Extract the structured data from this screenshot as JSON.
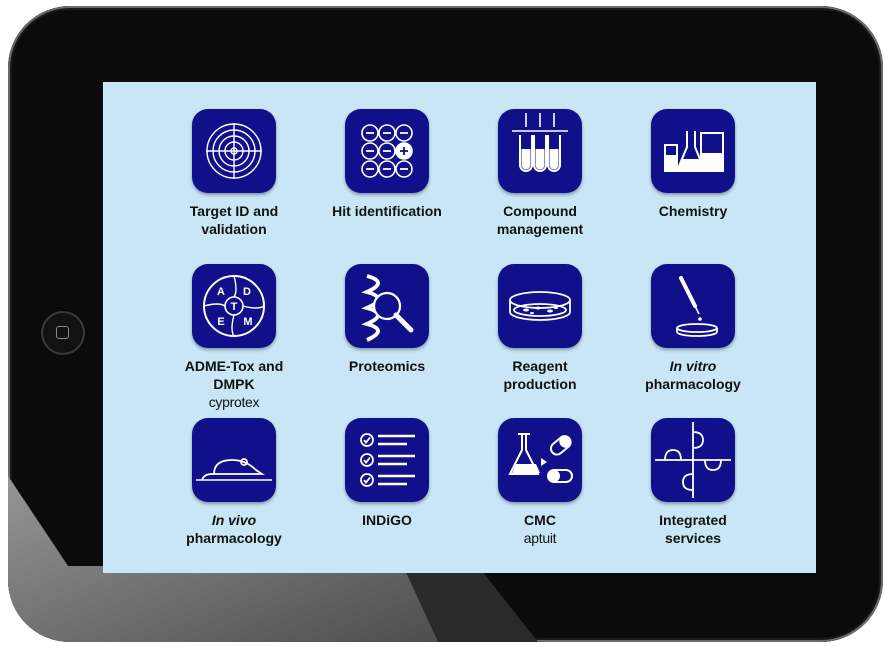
{
  "colors": {
    "tile": "#10108a",
    "screen": "#c8e6f5",
    "bezel": "#0b0b0b"
  },
  "apps": [
    {
      "id": "target",
      "line1": "Target ID and",
      "line2": "validation",
      "icon": "target-icon"
    },
    {
      "id": "hit",
      "line1": "Hit identification",
      "line2": "",
      "icon": "plate-wells-icon"
    },
    {
      "id": "compound",
      "line1": "Compound",
      "line2": "management",
      "icon": "test-tubes-icon"
    },
    {
      "id": "chemistry",
      "line1": "Chemistry",
      "line2": "",
      "icon": "flasks-icon"
    },
    {
      "id": "adme",
      "line1": "ADME-Tox and DMPK",
      "line2": "cyprotex",
      "icon": "adme-circle-icon"
    },
    {
      "id": "proteomics",
      "line1": "Proteomics",
      "line2": "",
      "icon": "helix-magnifier-icon"
    },
    {
      "id": "reagent",
      "line1": "Reagent",
      "line2": "production",
      "icon": "petri-dish-icon"
    },
    {
      "id": "invitro",
      "line1_italic": "In vitro",
      "line2": "pharmacology",
      "icon": "dropper-icon"
    },
    {
      "id": "invivo",
      "line1_italic": "In vivo",
      "line2": "pharmacology",
      "icon": "mouse-icon"
    },
    {
      "id": "indigo",
      "line1": "INDiGO",
      "line2": "",
      "icon": "checklist-icon"
    },
    {
      "id": "cmc",
      "line1": "CMC",
      "line2": "aptuit",
      "icon": "flask-pill-icon"
    },
    {
      "id": "integrated",
      "line1": "Integrated",
      "line2": "services",
      "icon": "puzzle-icon"
    }
  ],
  "adme_letters": [
    "A",
    "D",
    "T",
    "E",
    "M"
  ]
}
